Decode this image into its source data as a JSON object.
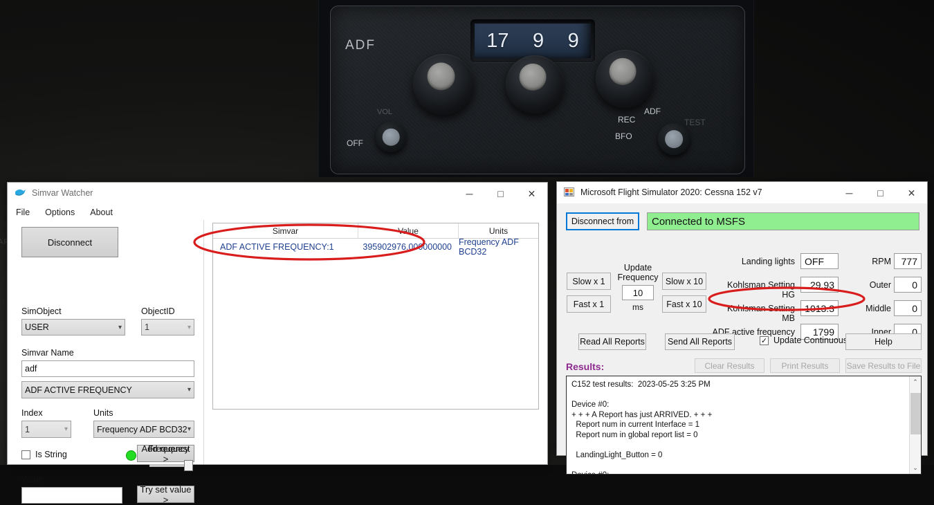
{
  "desktop": {
    "edge_text": "AR"
  },
  "adf_panel": {
    "label": "ADF",
    "display_digits": [
      "17",
      "9",
      "9"
    ],
    "off_label": "OFF",
    "vol_label": "VOL",
    "rec_label": "REC",
    "bfo_label": "BFO",
    "adf_mode_label": "ADF",
    "test_label": "TEST"
  },
  "simvar_watcher": {
    "title": "Simvar Watcher",
    "menu": [
      "File",
      "Options",
      "About"
    ],
    "window_buttons": {
      "minimize": "─",
      "maximize": "□",
      "close": "✕"
    },
    "disconnect_button": "Disconnect",
    "frequency_label": "Frequency",
    "simobject_label": "SimObject",
    "simobject_value": "USER",
    "objectid_label": "ObjectID",
    "objectid_value": "1",
    "simvar_name_label": "Simvar Name",
    "simvar_name_value": "adf",
    "simvar_select_value": "ADF ACTIVE FREQUENCY",
    "index_label": "Index",
    "index_value": "1",
    "units_label": "Units",
    "units_value": "Frequency ADF BCD32",
    "is_string_label": "Is String",
    "is_string_checked": "",
    "add_request_button": "Add request >",
    "value_label": "Value",
    "value_input": "",
    "try_set_value_button": "Try set value >",
    "grid": {
      "headers": [
        "Simvar",
        "Value",
        "Units"
      ],
      "rows": [
        {
          "simvar": "ADF ACTIVE FREQUENCY:1",
          "value": "395902976.000000000",
          "units": "Frequency ADF BCD32"
        }
      ]
    }
  },
  "msfs_window": {
    "title": "Microsoft Flight Simulator 2020: Cessna 152 v7",
    "window_buttons": {
      "minimize": "─",
      "maximize": "□",
      "close": "✕"
    },
    "disconnect_button": "Disconnect from",
    "status": "Connected to MSFS",
    "status_color": "#90ee90",
    "update_frequency_label": "Update\nFrequency",
    "update_frequency_value": "10",
    "ms_label": "ms",
    "speed_buttons": [
      "Slow x 1",
      "Slow x 10",
      "Fast x 1",
      "Fast x 10"
    ],
    "fields_left": [
      {
        "label": "Landing lights",
        "value": "OFF",
        "align": "left"
      },
      {
        "label": "Kohlsman Setting HG",
        "value": "29.93",
        "align": "right"
      },
      {
        "label": "Kohlsman Setting MB",
        "value": "1013.3",
        "align": "right"
      },
      {
        "label": "ADF active frequency",
        "value": "1799",
        "align": "right"
      }
    ],
    "fields_right": [
      {
        "label": "RPM",
        "value": "777"
      },
      {
        "label": "Outer",
        "value": "0"
      },
      {
        "label": "Middle",
        "value": "0"
      },
      {
        "label": "Inner",
        "value": "0"
      }
    ],
    "read_all_button": "Read All Reports",
    "send_all_button": "Send All Reports",
    "update_continuously_label": "Update Continuously",
    "update_continuously_checked": "✓",
    "help_button": "Help",
    "results_label": "Results:",
    "results_label_color": "#8e2a8e",
    "clear_results_button": "Clear Results",
    "print_results_button": "Print Results",
    "save_results_button": "Save Results to File",
    "results_text": "C152 test results:  2023-05-25 3:25 PM\n\nDevice #0:\n+ + + A Report has just ARRIVED. + + +\n  Report num in current Interface = 1\n  Report num in global report list = 0\n\n  LandingLight_Button = 0\n\nDevice #0:",
    "scrollbar": {
      "up": "⌃",
      "down": "⌄"
    }
  },
  "annotations": {
    "color": "#d91d1d",
    "count": 2
  }
}
